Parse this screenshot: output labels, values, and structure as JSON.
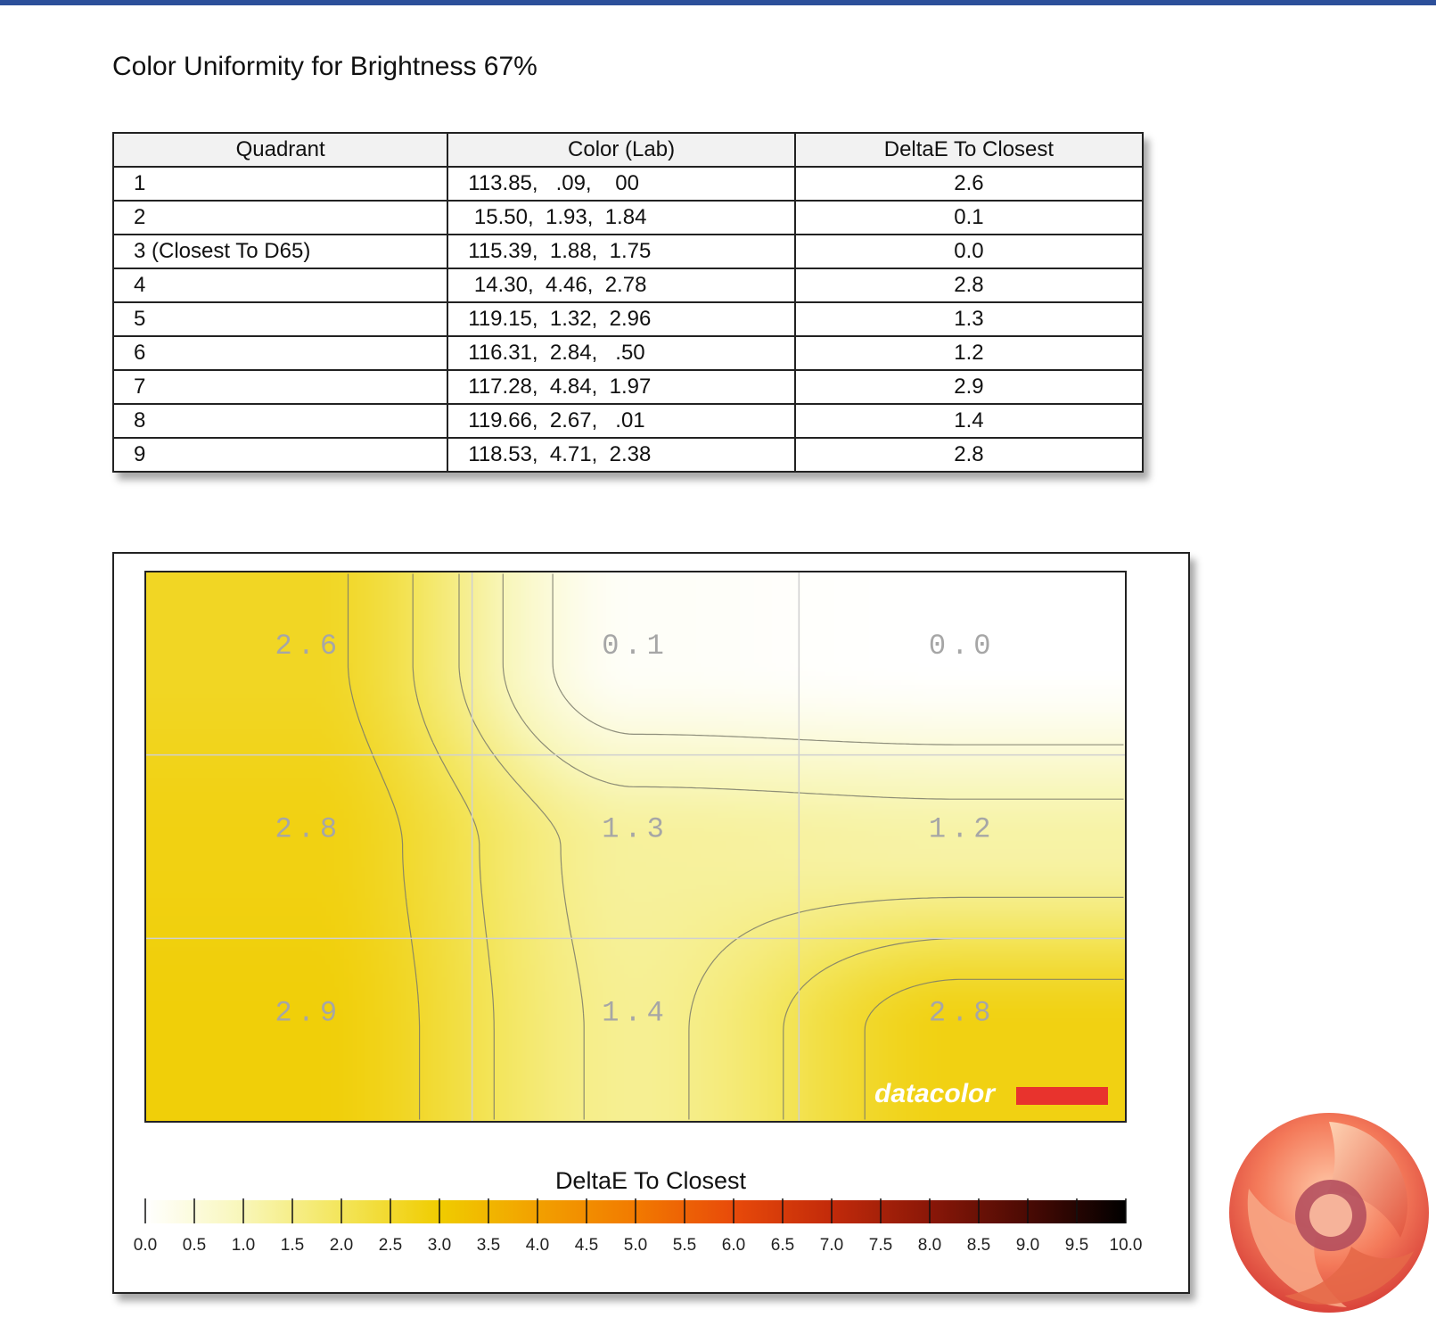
{
  "title": "Color Uniformity for Brightness 67%",
  "table": {
    "headers": [
      "Quadrant",
      "Color (Lab)",
      "DeltaE To Closest"
    ],
    "rows": [
      {
        "quadrant": "1",
        "lab": "113.85,   .09,    00",
        "delta": "2.6"
      },
      {
        "quadrant": "2",
        "lab": " 15.50,  1.93,  1.84",
        "delta": "0.1"
      },
      {
        "quadrant": "3 (Closest To D65)",
        "lab": "115.39,  1.88,  1.75",
        "delta": "0.0"
      },
      {
        "quadrant": "4",
        "lab": " 14.30,  4.46,  2.78",
        "delta": "2.8"
      },
      {
        "quadrant": "5",
        "lab": "119.15,  1.32,  2.96",
        "delta": "1.3"
      },
      {
        "quadrant": "6",
        "lab": "116.31,  2.84,   .50",
        "delta": "1.2"
      },
      {
        "quadrant": "7",
        "lab": "117.28,  4.84,  1.97",
        "delta": "2.9"
      },
      {
        "quadrant": "8",
        "lab": "119.66,  2.67,   .01",
        "delta": "1.4"
      },
      {
        "quadrant": "9",
        "lab": "118.53,  4.71,  2.38",
        "delta": "2.8"
      }
    ]
  },
  "chart_data": {
    "type": "heatmap",
    "rows": 3,
    "cols": 3,
    "values": [
      [
        2.6,
        0.1,
        0.0
      ],
      [
        2.8,
        1.3,
        1.2
      ],
      [
        2.9,
        1.4,
        2.8
      ]
    ],
    "cell_labels": [
      [
        "2.6",
        "0.1",
        "0.0"
      ],
      [
        "2.8",
        "1.3",
        "1.2"
      ],
      [
        "2.9",
        "1.4",
        "2.8"
      ]
    ],
    "colorbar": {
      "title": "DeltaE To Closest",
      "min": 0,
      "max": 10,
      "tick_labels": [
        "0.0",
        "0.5",
        "1.0",
        "1.5",
        "2.0",
        "2.5",
        "3.0",
        "3.5",
        "4.0",
        "4.5",
        "5.0",
        "5.5",
        "6.0",
        "6.5",
        "7.0",
        "7.5",
        "8.0",
        "8.5",
        "9.0",
        "9.5",
        "10.0"
      ]
    },
    "colorscale": [
      [
        0.0,
        "#ffffff"
      ],
      [
        1.0,
        "#f8f6b8"
      ],
      [
        2.0,
        "#f3e55a"
      ],
      [
        3.0,
        "#f0cc00"
      ],
      [
        4.0,
        "#f2a000"
      ],
      [
        5.0,
        "#f27a00"
      ],
      [
        6.0,
        "#e84a0a"
      ],
      [
        7.0,
        "#c22a0a"
      ],
      [
        8.0,
        "#8a1708"
      ],
      [
        9.0,
        "#4a0a04"
      ],
      [
        10.0,
        "#000000"
      ]
    ],
    "contour_levels": [
      0.5,
      1.0,
      1.5,
      2.0,
      2.5
    ],
    "grid": true
  },
  "watermark": "datacolor"
}
